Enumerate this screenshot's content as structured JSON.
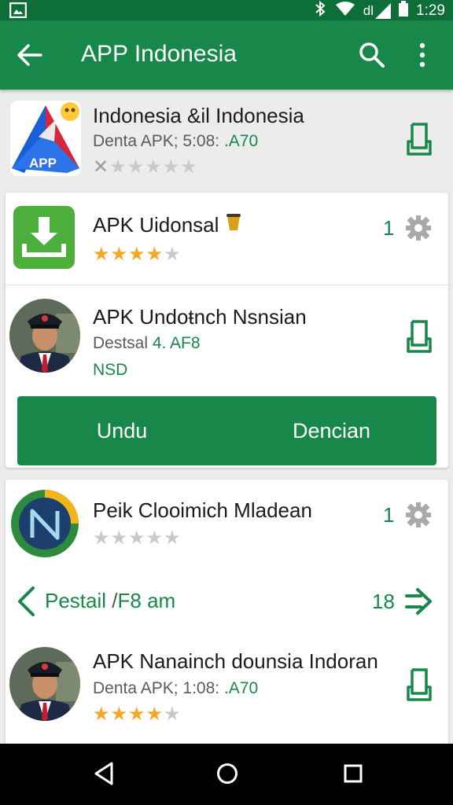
{
  "status": {
    "time": "1:29",
    "signal_text": "dl"
  },
  "appbar": {
    "title": "APP Indonesia"
  },
  "colors": {
    "primary": "#17874a",
    "primary_dark": "#0d6e38",
    "star": "#f5a623"
  },
  "items": [
    {
      "name": "Indonesia &il Indonesia",
      "sub_a": "Denta APK;  5:08: ",
      "sub_b": ".A70",
      "icon_label": "APP",
      "rating": 0,
      "icon": "app-logo-icon"
    },
    {
      "name": "APK Uidonsal",
      "rating": 4,
      "count": "1",
      "icon": "download-app-icon"
    },
    {
      "name": "APK Undoŧnch Nsnsian",
      "sub_a": "Destsal ",
      "sub_b": "4. AF8",
      "extra": "NSD",
      "icon": "avatar-photo"
    },
    {
      "name": "Peik Clooimich Mladean",
      "rating": 0,
      "count": "1",
      "icon": "n-logo-icon"
    },
    {
      "name": "APK Nanainch dounsia Indoran",
      "sub_a": "Denta APK;  1:08: ",
      "sub_b": ".A70",
      "rating": 4,
      "icon": "avatar-photo"
    }
  ],
  "buttons": {
    "left": "Undu",
    "right": "Dencian"
  },
  "pager": {
    "label": "Pestail",
    "sep": "/",
    "label2": "F8 am",
    "count": "18"
  }
}
